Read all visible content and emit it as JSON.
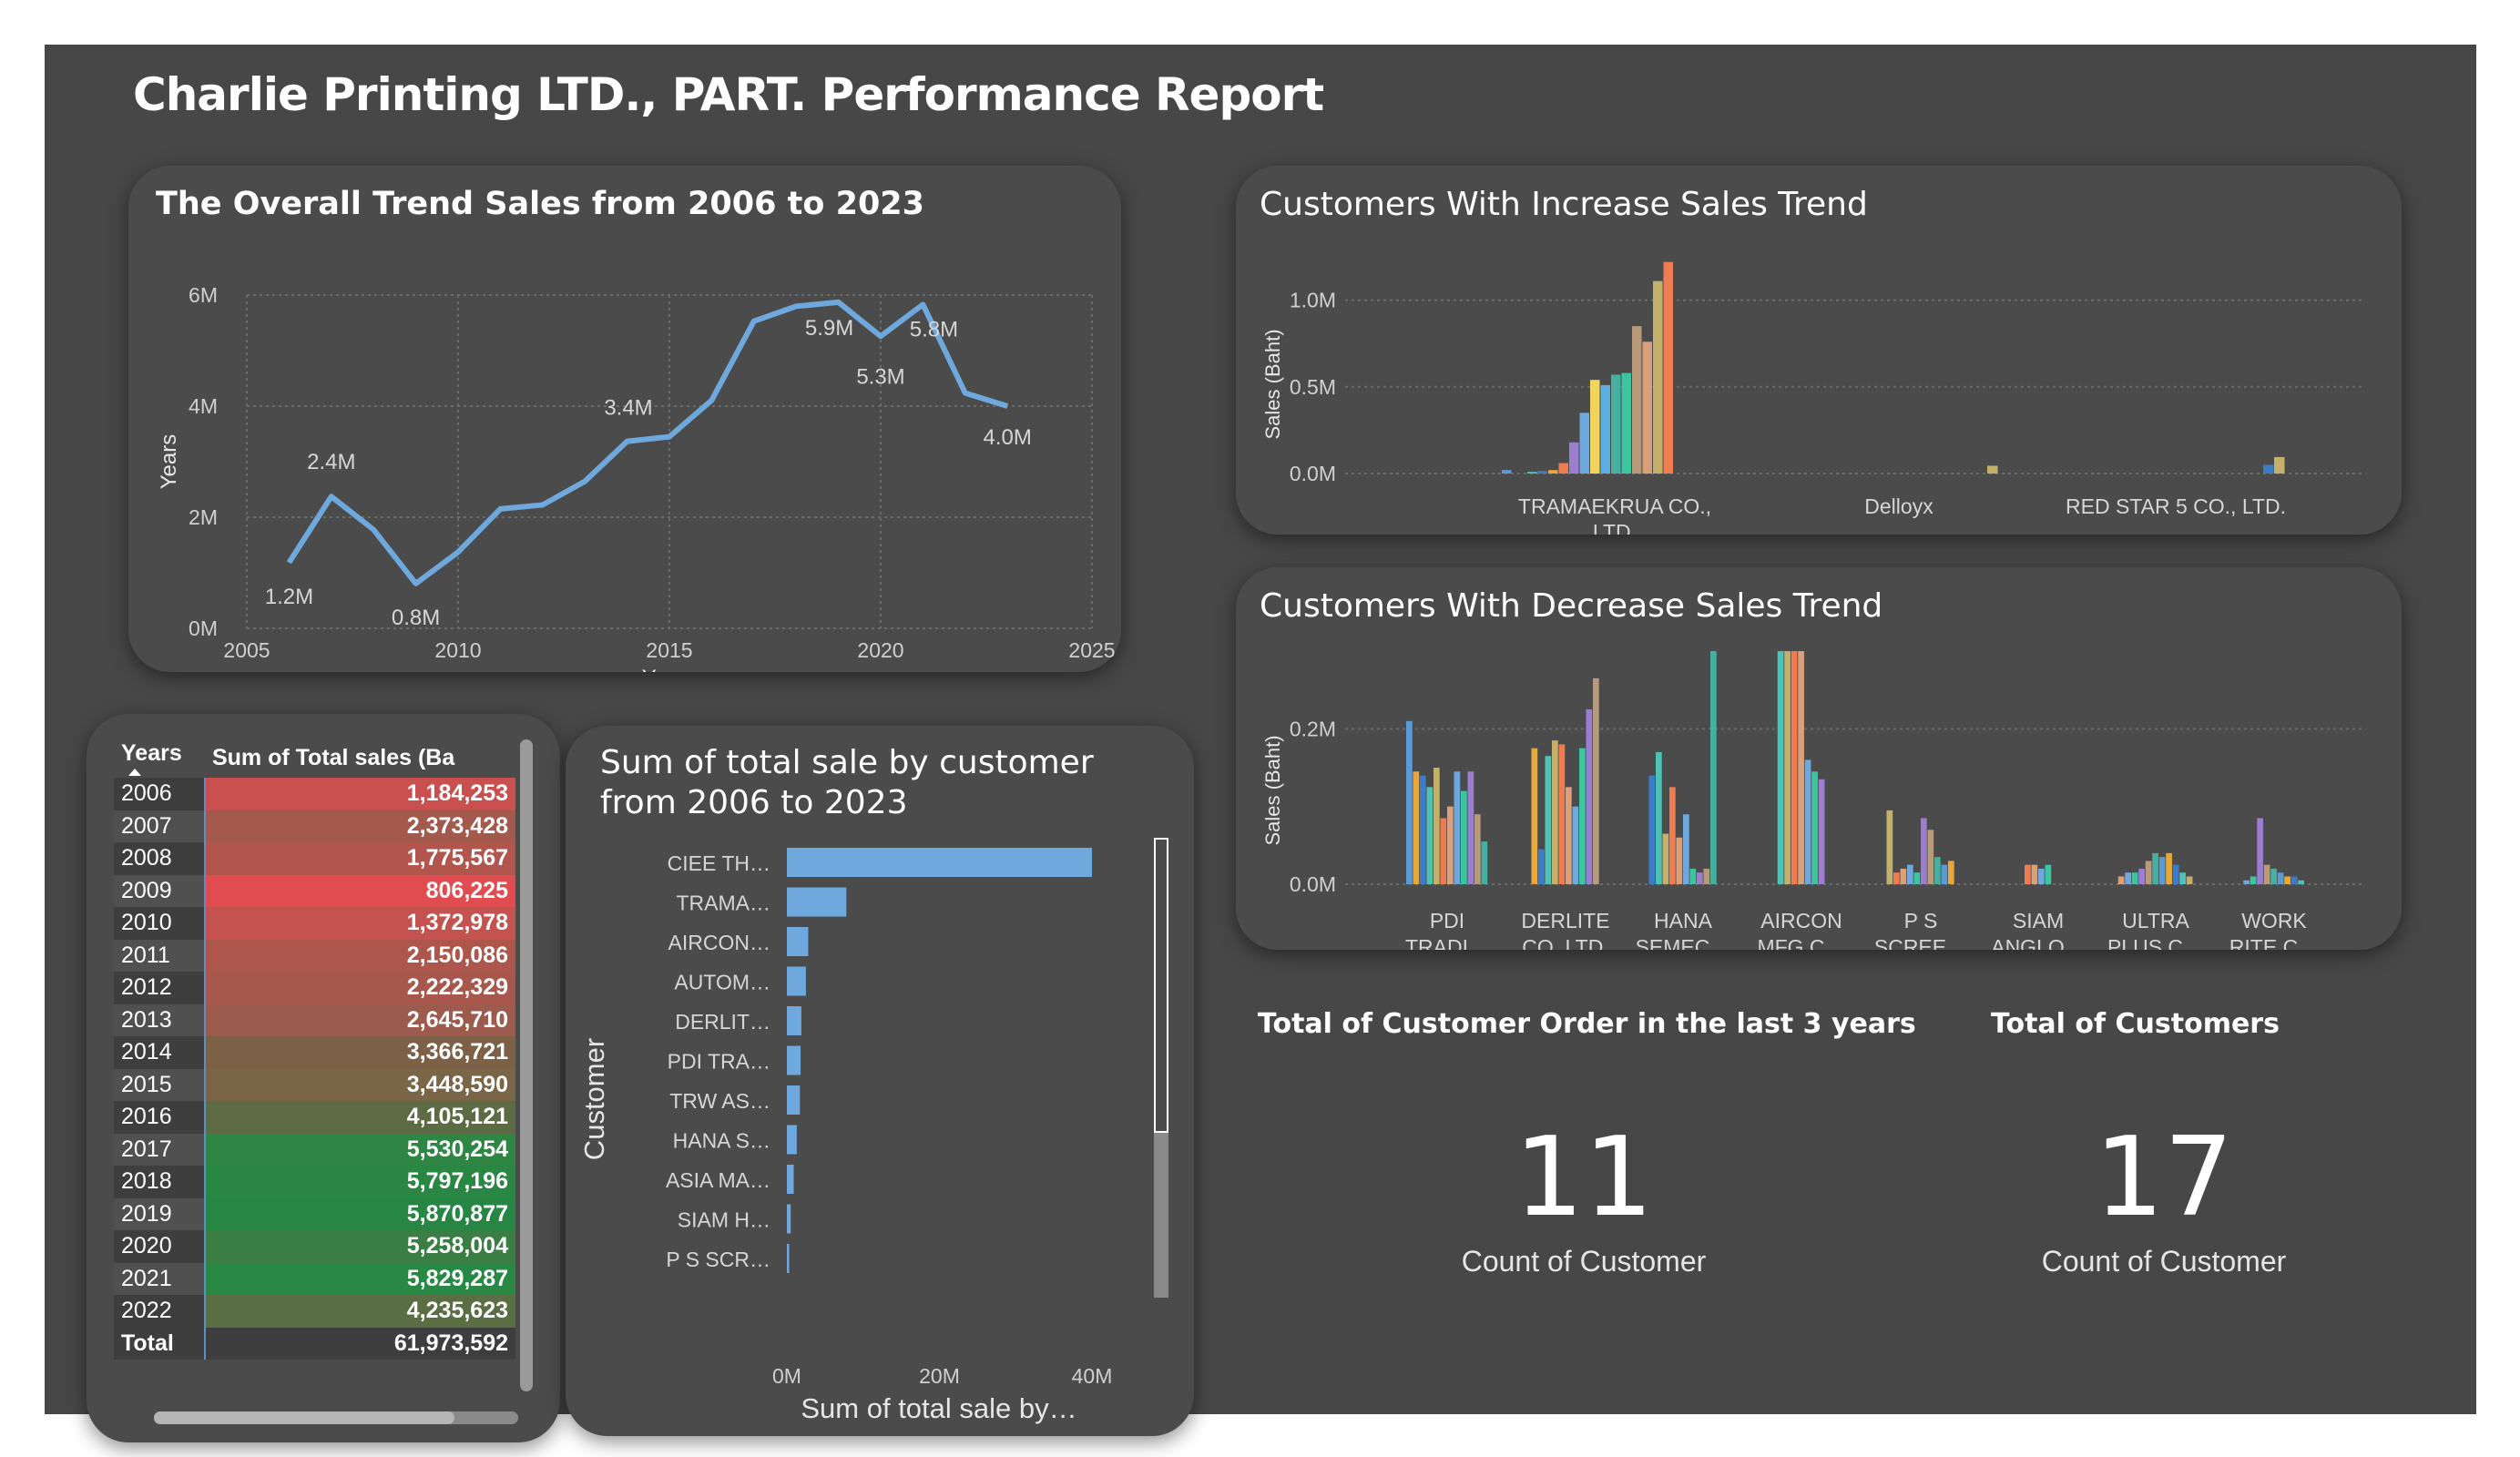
{
  "report": {
    "title": "Charlie Printing LTD., PART. Performance Report"
  },
  "trend": {
    "title": "The Overall Trend Sales from 2006 to 2023",
    "chart_data": {
      "type": "line",
      "title": "The Overall Trend Sales from 2006 to 2023",
      "xlabel": "Years",
      "ylabel": "Years",
      "xlim": [
        2005,
        2025
      ],
      "ylim": [
        0,
        6000000
      ],
      "x_ticks": [
        "2005",
        "2010",
        "2015",
        "2020",
        "2025"
      ],
      "y_ticks": [
        "0M",
        "2M",
        "4M",
        "6M"
      ],
      "x": [
        2006,
        2007,
        2008,
        2009,
        2010,
        2011,
        2012,
        2013,
        2014,
        2015,
        2016,
        2017,
        2018,
        2019,
        2020,
        2021,
        2022,
        2023
      ],
      "values": [
        1184253,
        2373428,
        1775567,
        806225,
        1372978,
        2150086,
        2222329,
        2645710,
        3366721,
        3448590,
        4105121,
        5530254,
        5797196,
        5870877,
        5258004,
        5829287,
        4235623,
        4000000
      ],
      "data_labels": [
        {
          "x": 2006,
          "text": "1.2M"
        },
        {
          "x": 2007,
          "text": "2.4M"
        },
        {
          "x": 2009,
          "text": "0.8M"
        },
        {
          "x": 2015,
          "text": "3.4M"
        },
        {
          "x": 2019,
          "text": "5.9M"
        },
        {
          "x": 2020,
          "text": "5.3M"
        },
        {
          "x": 2021,
          "text": "5.8M"
        },
        {
          "x": 2023,
          "text": "4.0M"
        }
      ],
      "color": "#6fa8dc"
    }
  },
  "increase": {
    "title": "Customers With Increase Sales Trend",
    "chart_data": {
      "type": "bar",
      "title": "Customers With Increase Sales Trend",
      "ylabel": "Sales (Baht)",
      "ylim": [
        0,
        1250000
      ],
      "y_ticks": [
        "0.0M",
        "0.5M",
        "1.0M"
      ],
      "categories": [
        "TRAMAEKRUA CO., LTD.",
        "Delloyx",
        "RED STAR 5 CO., LTD."
      ],
      "category_lines": [
        [
          "TRAMAEKRUA CO.,",
          "LTD."
        ],
        [
          "Delloyx"
        ],
        [
          "RED STAR 5 CO., LTD."
        ]
      ],
      "series_values": [
        [
          20000,
          0,
          0,
          0,
          0,
          0,
          0,
          0,
          0
        ],
        [
          10000,
          15000,
          20000,
          60000,
          180000,
          350000,
          540000,
          510000,
          570000,
          580000,
          850000,
          760000,
          1110000,
          1220000
        ],
        [
          45000
        ],
        [
          50000,
          95000
        ]
      ],
      "colors": [
        "#5b9bd5",
        "#4ec3b5",
        "#3d7cc9",
        "#e8a838",
        "#f07c52",
        "#9b7ed0",
        "#6fa8dc",
        "#f2d45c",
        "#5aaee0",
        "#45b0a0",
        "#3cc6a0",
        "#b89a7a",
        "#d9a07a",
        "#c4b06a",
        "#f07c52",
        "#c9a45a"
      ]
    }
  },
  "decrease": {
    "title": "Customers With Decrease Sales Trend",
    "chart_data": {
      "type": "bar",
      "title": "Customers With Decrease Sales Trend",
      "ylabel": "Sales (Baht)",
      "ylim": [
        0,
        0.3
      ],
      "y_ticks": [
        "0.0M",
        "0.2M"
      ],
      "categories": [
        "PDI TRADI…",
        "DERLITE CO.,LTD.",
        "HANA SEMEC…",
        "AIRCON MFG C…",
        "P S SCREE…",
        "SIAM ANGLO…",
        "ULTRA PLUS C…",
        "WORK RITE C…"
      ],
      "category_lines": [
        [
          "PDI",
          "TRADI…"
        ],
        [
          "DERLITE",
          "CO.,LTD."
        ],
        [
          "HANA",
          "SEMEC…"
        ],
        [
          "AIRCON",
          "MFG C…"
        ],
        [
          "P S",
          "SCREE…"
        ],
        [
          "SIAM",
          "ANGLO…"
        ],
        [
          "ULTRA",
          "PLUS C…"
        ],
        [
          "WORK",
          "RITE C…"
        ]
      ],
      "groups": [
        [
          0.21,
          0.145,
          0.14,
          0.125,
          0.15,
          0.085,
          0.1,
          0.145,
          0.12,
          0.145,
          0.09,
          0.055
        ],
        [
          0.175,
          0.045,
          0.165,
          0.185,
          0.18,
          0.125,
          0.1,
          0.175,
          0.225,
          0.265
        ],
        [
          0.14,
          0.17,
          0.065,
          0.125,
          0.06,
          0.09,
          0.02,
          0.015,
          0.02,
          0.3
        ],
        [
          0.3,
          0.3,
          0.3,
          0.3,
          0.16,
          0.145,
          0.135
        ],
        [
          0.095,
          0.015,
          0.02,
          0.025,
          0.015,
          0.085,
          0.07,
          0.035,
          0.025,
          0.03
        ],
        [
          0.025,
          0.025,
          0.02,
          0.025
        ],
        [
          0.01,
          0.015,
          0.015,
          0.02,
          0.03,
          0.04,
          0.035,
          0.04,
          0.025,
          0.015,
          0.01
        ],
        [
          0.005,
          0.01,
          0.085,
          0.025,
          0.02,
          0.015,
          0.01,
          0.01,
          0.005
        ]
      ],
      "colors": [
        "#5b9bd5",
        "#e8a838",
        "#3d7cc9",
        "#4ec3b5",
        "#c4b06a",
        "#f07c52",
        "#d9a07a",
        "#6fa8dc",
        "#3cc6a0",
        "#9b7ed0",
        "#b89a7a",
        "#45b0a0"
      ]
    }
  },
  "table": {
    "headers": [
      "Years",
      "Sum of Total sales (Ba"
    ],
    "rows": [
      {
        "year": "2006",
        "value": "1,184,253",
        "color": "#c9504f"
      },
      {
        "year": "2007",
        "value": "2,373,428",
        "color": "#a3594c"
      },
      {
        "year": "2008",
        "value": "1,775,567",
        "color": "#b1554d"
      },
      {
        "year": "2009",
        "value": "806,225",
        "color": "#e04c4f"
      },
      {
        "year": "2010",
        "value": "1,372,978",
        "color": "#c4524e"
      },
      {
        "year": "2011",
        "value": "2,150,086",
        "color": "#ac564c"
      },
      {
        "year": "2012",
        "value": "2,222,329",
        "color": "#a7574c"
      },
      {
        "year": "2013",
        "value": "2,645,710",
        "color": "#9c5b4c"
      },
      {
        "year": "2014",
        "value": "3,366,721",
        "color": "#7c6147"
      },
      {
        "year": "2015",
        "value": "3,448,590",
        "color": "#7a6546"
      },
      {
        "year": "2016",
        "value": "4,105,121",
        "color": "#5c6b43"
      },
      {
        "year": "2017",
        "value": "5,530,254",
        "color": "#2f8543"
      },
      {
        "year": "2018",
        "value": "5,797,196",
        "color": "#2a8643"
      },
      {
        "year": "2019",
        "value": "5,870,877",
        "color": "#288644"
      },
      {
        "year": "2020",
        "value": "5,258,004",
        "color": "#3a7e44"
      },
      {
        "year": "2021",
        "value": "5,829,287",
        "color": "#288844"
      },
      {
        "year": "2022",
        "value": "4,235,623",
        "color": "#5a6e43"
      }
    ],
    "total_label": "Total",
    "total_value": "61,973,592"
  },
  "customers": {
    "title_line1": "Sum of total sale by customer",
    "title_line2": "from 2006 to 2023",
    "chart_data": {
      "type": "bar",
      "orientation": "horizontal",
      "title": "Sum of total sale by customer from 2006 to 2023",
      "xlabel": "Sum of total sale by…",
      "ylabel": "Customer",
      "xlim": [
        0,
        40000000
      ],
      "x_ticks": [
        "0M",
        "20M",
        "40M"
      ],
      "categories": [
        "CIEE TH…",
        "TRAMA…",
        "AIRCON…",
        "AUTOM…",
        "DERLIT…",
        "PDI TRA…",
        "TRW AS…",
        "HANA S…",
        "ASIA MA…",
        "SIAM H…",
        "P S SCR…"
      ],
      "values": [
        40000000,
        7800000,
        2800000,
        2500000,
        1900000,
        1800000,
        1700000,
        1300000,
        900000,
        500000,
        300000
      ],
      "color": "#6fa8dc"
    }
  },
  "kpi1": {
    "label": "Total of Customer Order in the last 3 years",
    "value": "11",
    "sub": "Count of Customer"
  },
  "kpi2": {
    "label": "Total of Customers",
    "value": "17",
    "sub": "Count of Customer"
  }
}
